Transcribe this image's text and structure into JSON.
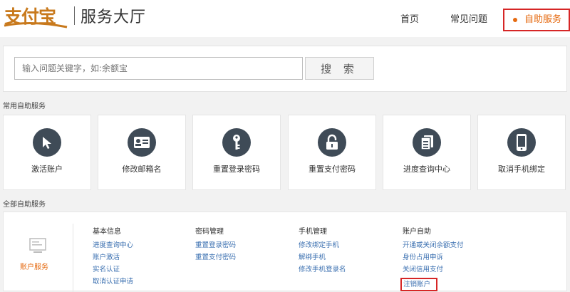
{
  "header": {
    "logo_text": "支付宝",
    "title": "服务大厅",
    "nav": [
      {
        "label": "首页"
      },
      {
        "label": "常见问题"
      },
      {
        "label": "自助服务"
      }
    ]
  },
  "search": {
    "placeholder": "输入问题关键字，如:余额宝",
    "button_label": "搜 索"
  },
  "common": {
    "title": "常用自助服务",
    "items": [
      {
        "label": "激活账户",
        "icon": "cursor-click-icon"
      },
      {
        "label": "修改邮箱名",
        "icon": "id-card-icon"
      },
      {
        "label": "重置登录密码",
        "icon": "key-icon"
      },
      {
        "label": "重置支付密码",
        "icon": "lock-icon"
      },
      {
        "label": "进度查询中心",
        "icon": "documents-icon"
      },
      {
        "label": "取消手机绑定",
        "icon": "mobile-phone-icon"
      }
    ]
  },
  "all": {
    "title": "全部自助服务",
    "category_label": "账户服务",
    "columns": [
      {
        "title": "基本信息",
        "links": [
          "进度查询中心",
          "账户激活",
          "实名认证",
          "取消认证申请"
        ]
      },
      {
        "title": "密码管理",
        "links": [
          "重置登录密码",
          "重置支付密码"
        ]
      },
      {
        "title": "手机管理",
        "links": [
          "修改绑定手机",
          "解绑手机",
          "修改手机登录名"
        ]
      },
      {
        "title": "账户自助",
        "links": [
          "开通或关闭余额支付",
          "身份占用申诉",
          "关闭信用支付",
          "注销账户"
        ]
      }
    ]
  },
  "colors": {
    "accent": "#e56a10",
    "highlight_box": "#d62626",
    "icon_bg": "#3f4b57",
    "link": "#3a6fb0"
  }
}
